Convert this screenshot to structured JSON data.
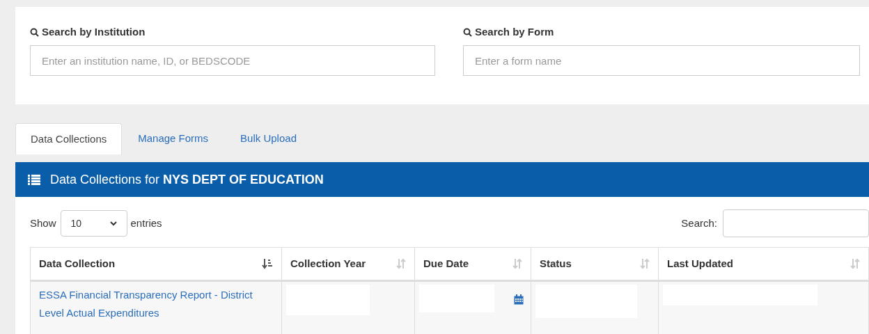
{
  "search_panel": {
    "fields": [
      {
        "label": "Search by Institution",
        "placeholder": "Enter an institution name, ID, or BEDSCODE"
      },
      {
        "label": "Search by Form",
        "placeholder": "Enter a form name"
      }
    ]
  },
  "tabs": [
    {
      "label": "Data Collections",
      "selected": true
    },
    {
      "label": "Manage Forms",
      "selected": false
    },
    {
      "label": "Bulk Upload",
      "selected": false
    }
  ],
  "panel": {
    "title": "Data Collections for **NYS DEPT OF EDUCATION**",
    "length_menu": {
      "before": "Show",
      "value": "10",
      "after": "entries"
    },
    "search_label": "Search:",
    "table": {
      "columns": [
        {
          "label": "Data Collection",
          "sorted": true
        },
        {
          "label": "Collection Year",
          "sorted": false
        },
        {
          "label": "Due Date",
          "sorted": false
        },
        {
          "label": "Status",
          "sorted": false
        },
        {
          "label": "Last Updated",
          "sorted": false
        }
      ],
      "rows": [
        {
          "data_collection": "ESSA Financial Transparency Report - District Level Actual Expenditures"
        }
      ]
    }
  }
}
